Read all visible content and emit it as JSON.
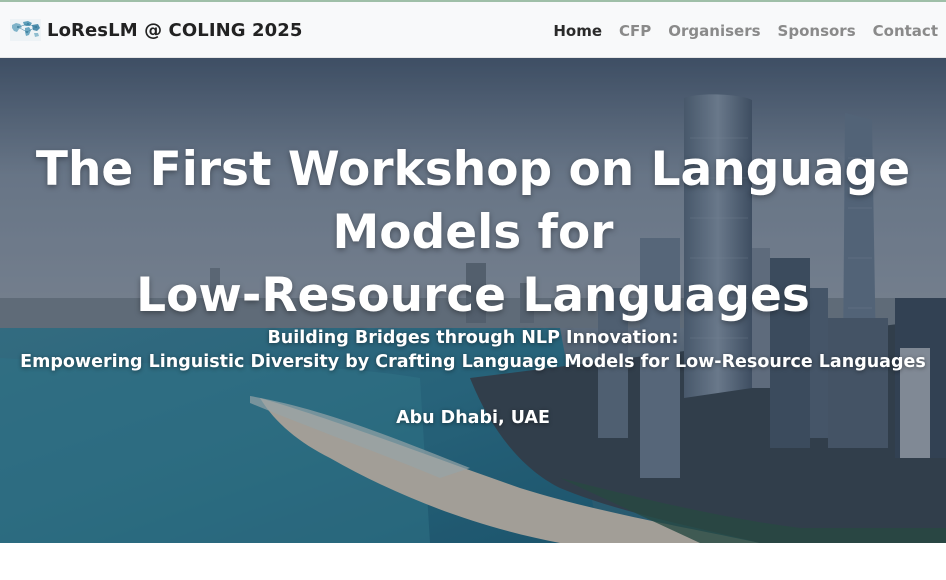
{
  "navbar": {
    "brand_text": "LoResLM @ COLING 2025",
    "brand_logo_icon": "world-map-logo-icon",
    "links": [
      {
        "label": "Home",
        "active": true
      },
      {
        "label": "CFP",
        "active": false
      },
      {
        "label": "Organisers",
        "active": false
      },
      {
        "label": "Sponsors",
        "active": false
      },
      {
        "label": "Contact",
        "active": false
      }
    ]
  },
  "hero": {
    "title_lines": [
      "The First Workshop on Language",
      "Models for",
      "Low-Resource Languages"
    ],
    "subtitle_lines": [
      "Building Bridges through NLP Innovation:",
      "Empowering Linguistic Diversity by Crafting Language Models for Low-Resource Languages"
    ],
    "location": "Abu Dhabi, UAE",
    "background_image": "city-skyline-beach-image"
  },
  "colors": {
    "navbar_bg": "#f8f9fa",
    "nav_active": "#2a2a2a",
    "nav_inactive": "#8a8a8a",
    "hero_text": "#ffffff"
  }
}
